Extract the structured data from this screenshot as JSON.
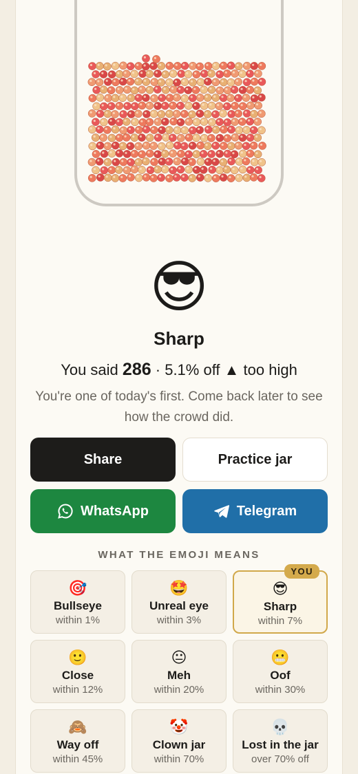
{
  "jar": {
    "bean_colors": [
      "#e9595a",
      "#ee7a5e",
      "#f09a72",
      "#e8b073",
      "#f0c38a",
      "#d94848"
    ]
  },
  "result": {
    "emoji": "😎",
    "verdict": "Sharp",
    "said_prefix": "You said",
    "guess": "286",
    "said_suffix": "· 5.1% off ▲ too high",
    "note": "You're one of today's first. Come back later to see how the crowd did."
  },
  "actions": {
    "share": "Share",
    "practice": "Practice jar",
    "whatsapp": "WhatsApp",
    "telegram": "Telegram"
  },
  "colors": {
    "whatsapp": "#1d8740",
    "telegram": "#206fa8",
    "dark": "#1d1c1a",
    "you_badge": "#d4aa4c"
  },
  "legend": {
    "title": "WHAT THE EMOJI MEANS",
    "you_badge": "YOU",
    "items": [
      {
        "emoji": "🎯",
        "name": "Bullseye",
        "range": "within 1%"
      },
      {
        "emoji": "🤩",
        "name": "Unreal eye",
        "range": "within 3%"
      },
      {
        "emoji": "😎",
        "name": "Sharp",
        "range": "within 7%"
      },
      {
        "emoji": "🙂",
        "name": "Close",
        "range": "within 12%"
      },
      {
        "emoji": "😐",
        "name": "Meh",
        "range": "within 20%"
      },
      {
        "emoji": "😬",
        "name": "Oof",
        "range": "within 30%"
      },
      {
        "emoji": "🙈",
        "name": "Way off",
        "range": "within 45%"
      },
      {
        "emoji": "🤡",
        "name": "Clown jar",
        "range": "within 70%"
      },
      {
        "emoji": "💀",
        "name": "Lost in the jar",
        "range": "over 70% off"
      }
    ]
  }
}
